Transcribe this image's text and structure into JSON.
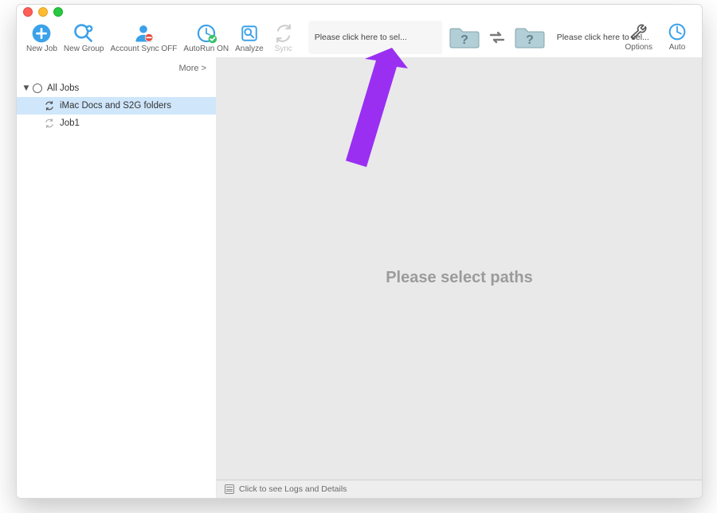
{
  "toolbar": {
    "new_job": "New Job",
    "new_group": "New Group",
    "account_sync": "Account Sync OFF",
    "autorun": "AutoRun ON",
    "analyze": "Analyze",
    "sync": "Sync",
    "options": "Options",
    "auto": "Auto"
  },
  "path_picker": {
    "left_text": "Please click here to sel...",
    "right_text": "Please click here to sel..."
  },
  "sidebar": {
    "more_label": "More >",
    "root_label": "All Jobs",
    "items": [
      {
        "label": "iMac Docs and S2G folders",
        "selected": true
      },
      {
        "label": "Job1",
        "selected": false
      }
    ]
  },
  "main": {
    "placeholder": "Please select paths"
  },
  "statusbar": {
    "text": "Click to see Logs and Details"
  },
  "colors": {
    "accent_blue": "#3aa1ea",
    "folder_teal": "#a9c7cf",
    "arrow_purple": "#9a2ff2",
    "selection": "#cfe6fb"
  }
}
